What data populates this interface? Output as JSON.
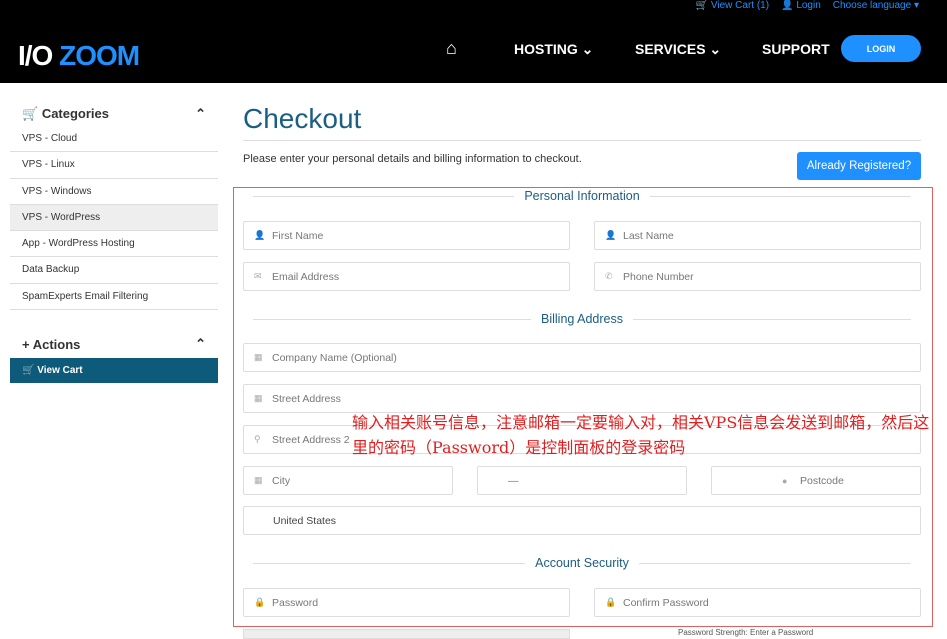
{
  "topbar": {
    "view_cart": "View Cart (1)",
    "login": "Login",
    "language": "Choose language"
  },
  "logo": {
    "part1": "I/O ",
    "part2": "ZOOM"
  },
  "nav": {
    "hosting": "HOSTING",
    "services": "SERVICES",
    "support": "SUPPORT",
    "login_button": "LOGIN"
  },
  "sidebar": {
    "categories_title": "Categories",
    "items": [
      {
        "label": "VPS - Cloud"
      },
      {
        "label": "VPS - Linux"
      },
      {
        "label": "VPS - Windows"
      },
      {
        "label": "VPS - WordPress"
      },
      {
        "label": "App - WordPress Hosting"
      },
      {
        "label": "Data Backup"
      },
      {
        "label": "SpamExperts Email Filtering"
      }
    ],
    "actions_title": "Actions",
    "view_cart": "View Cart"
  },
  "main": {
    "title": "Checkout",
    "intro": "Please enter your personal details and billing information to checkout.",
    "already_registered": "Already Registered?",
    "personal_section": "Personal Information",
    "billing_section": "Billing Address",
    "security_section": "Account Security",
    "fields": {
      "first_name": "First Name",
      "last_name": "Last Name",
      "email": "Email Address",
      "phone": "Phone Number",
      "company": "Company Name (Optional)",
      "street": "Street Address",
      "street2": "Street Address 2",
      "city": "City",
      "state": "—",
      "postcode": "Postcode",
      "country": "United States",
      "password": "Password",
      "confirm_password": "Confirm Password"
    },
    "password_strength": "Password Strength: Enter a Password"
  },
  "annotation": "输入相关账号信息，注意邮箱一定要输入对，相关VPS信息会发送到邮箱，然后这里的密码（Password）是控制面板的登录密码",
  "colors": {
    "accent": "#1e90ff",
    "annotation": "#e02020"
  }
}
